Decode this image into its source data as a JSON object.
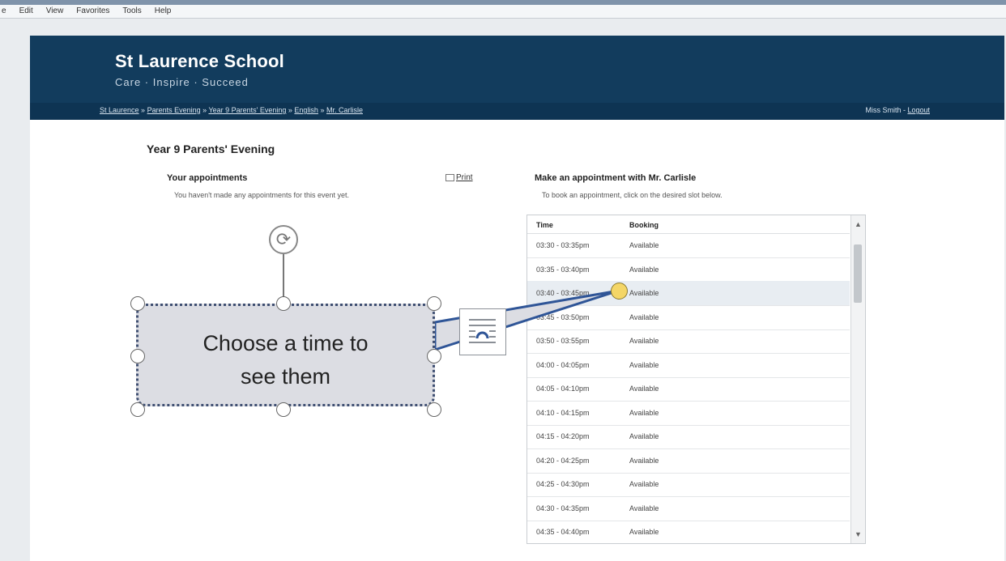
{
  "browser": {
    "menu": [
      "e",
      "Edit",
      "View",
      "Favorites",
      "Tools",
      "Help"
    ]
  },
  "header": {
    "school_name": "St Laurence School",
    "tagline": "Care · Inspire · Succeed",
    "breadcrumbs": [
      "St Laurence",
      "Parents Evening",
      "Year 9 Parents' Evening",
      "English",
      "Mr. Carlisle"
    ],
    "user_text": "Miss Smith",
    "logout_label": "Logout"
  },
  "page": {
    "title": "Year 9 Parents' Evening",
    "appointments_heading": "Your appointments",
    "print_label": "Print",
    "no_appointments_text": "You haven't made any appointments for this event yet.",
    "make_heading": "Make an appointment with Mr. Carlisle",
    "make_hint": "To book an appointment, click on the desired slot below.",
    "table": {
      "col_time": "Time",
      "col_booking": "Booking",
      "rows": [
        {
          "time": "03:30 - 03:35pm",
          "booking": "Available"
        },
        {
          "time": "03:35 - 03:40pm",
          "booking": "Available"
        },
        {
          "time": "03:40 - 03:45pm",
          "booking": "Available"
        },
        {
          "time": "03:45 - 03:50pm",
          "booking": "Available"
        },
        {
          "time": "03:50 - 03:55pm",
          "booking": "Available"
        },
        {
          "time": "04:00 - 04:05pm",
          "booking": "Available"
        },
        {
          "time": "04:05 - 04:10pm",
          "booking": "Available"
        },
        {
          "time": "04:10 - 04:15pm",
          "booking": "Available"
        },
        {
          "time": "04:15 - 04:20pm",
          "booking": "Available"
        },
        {
          "time": "04:20 - 04:25pm",
          "booking": "Available"
        },
        {
          "time": "04:25 - 04:30pm",
          "booking": "Available"
        },
        {
          "time": "04:30 - 04:35pm",
          "booking": "Available"
        },
        {
          "time": "04:35 - 04:40pm",
          "booking": "Available"
        }
      ]
    }
  },
  "callout": {
    "line1": "Choose  a time to",
    "line2": "see them"
  },
  "colors": {
    "header_bg": "#123c5d",
    "breadcrumb_bg": "#0e3453",
    "callout_fill": "#dcdde3",
    "callout_border": "#3f4f72",
    "connector": "#2f5597",
    "adjust_handle": "#f4d667"
  },
  "icons": {
    "rotate": "rotate-handle-icon",
    "layout_options": "layout-options-icon"
  }
}
